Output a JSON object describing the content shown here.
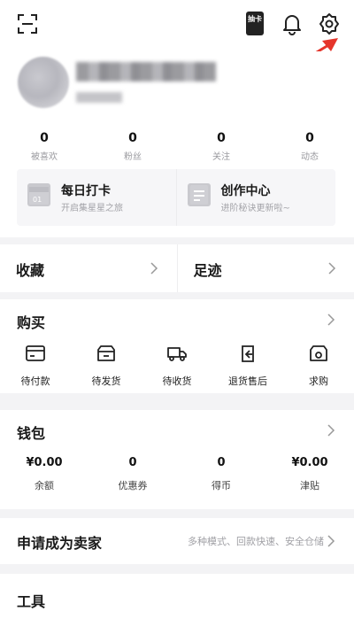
{
  "header": {
    "card_icon_text": "抽卡"
  },
  "stats": [
    {
      "value": "0",
      "label": "被喜欢"
    },
    {
      "value": "0",
      "label": "粉丝"
    },
    {
      "value": "0",
      "label": "关注"
    },
    {
      "value": "0",
      "label": "动态"
    }
  ],
  "cards": [
    {
      "title": "每日打卡",
      "subtitle": "开启集星星之旅",
      "icon_text": "01"
    },
    {
      "title": "创作中心",
      "subtitle": "进阶秘诀更新啦~"
    }
  ],
  "quick": {
    "favorites": "收藏",
    "footprints": "足迹"
  },
  "buy": {
    "title": "购买",
    "items": [
      {
        "label": "待付款",
        "icon": "card-icon"
      },
      {
        "label": "待发货",
        "icon": "box-icon"
      },
      {
        "label": "待收货",
        "icon": "truck-icon"
      },
      {
        "label": "退货售后",
        "icon": "return-icon"
      },
      {
        "label": "求购",
        "icon": "wanted-icon"
      }
    ]
  },
  "wallet": {
    "title": "钱包",
    "items": [
      {
        "value": "¥0.00",
        "label": "余额"
      },
      {
        "value": "0",
        "label": "优惠券"
      },
      {
        "value": "0",
        "label": "得币"
      },
      {
        "value": "¥0.00",
        "label": "津贴"
      }
    ]
  },
  "seller": {
    "title": "申请成为卖家",
    "note": "多种模式、回款快速、安全仓储"
  },
  "tools": {
    "title": "工具"
  },
  "colors": {
    "accent_arrow": "#e5352b",
    "page_bg": "#f3f3f5"
  }
}
